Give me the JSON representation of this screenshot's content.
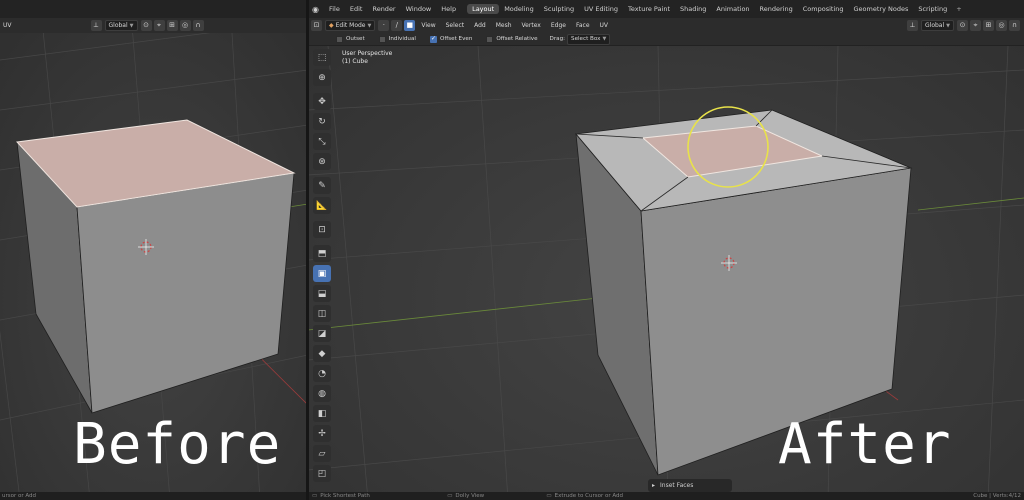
{
  "before_panel": {
    "header_mode": "UV",
    "orientation_value": "Global",
    "status_text": "ursor or Add",
    "overlay_label": "Before"
  },
  "after_panel": {
    "menu": [
      "File",
      "Edit",
      "Render",
      "Window",
      "Help"
    ],
    "workspace_tabs": [
      "Layout",
      "Modeling",
      "Sculpting",
      "UV Editing",
      "Texture Paint",
      "Shading",
      "Animation",
      "Rendering",
      "Compositing",
      "Geometry Nodes",
      "Scripting"
    ],
    "active_tab": "Layout",
    "edit_mode": "Edit Mode",
    "header_menus": [
      "View",
      "Select",
      "Add",
      "Mesh",
      "Vertex",
      "Edge",
      "Face",
      "UV"
    ],
    "orientation_value": "Global",
    "options": [
      {
        "label": "Outset",
        "checked": false
      },
      {
        "label": "Individual",
        "checked": false
      },
      {
        "label": "Offset Even",
        "checked": true
      },
      {
        "label": "Offset Relative",
        "checked": false
      }
    ],
    "drag_label": "Drag:",
    "drag_value": "Select Box",
    "viewport_title": "User Perspective",
    "viewport_object": "(1) Cube",
    "last_operator": "Inset Faces",
    "status_left": "Pick Shortest Path",
    "status_mid": "Dolly View",
    "status_right": "Extrude to Cursor or Add",
    "status_stats": "Cube | Verts:4/12",
    "overlay_label": "After"
  },
  "toolbar_icons": [
    "select-box",
    "cursor",
    "move",
    "rotate",
    "scale",
    "transform",
    "annotate",
    "measure",
    "add-cube",
    "extrude",
    "inset",
    "bevel",
    "loop-cut",
    "knife",
    "poly-build",
    "spin",
    "smooth",
    "edge-slide",
    "shrink-fatten",
    "shear",
    "rip"
  ],
  "colors": {
    "accent": "#4772b3",
    "face_selected": "#c9aea8",
    "highlight_circle": "#e8e24a"
  }
}
